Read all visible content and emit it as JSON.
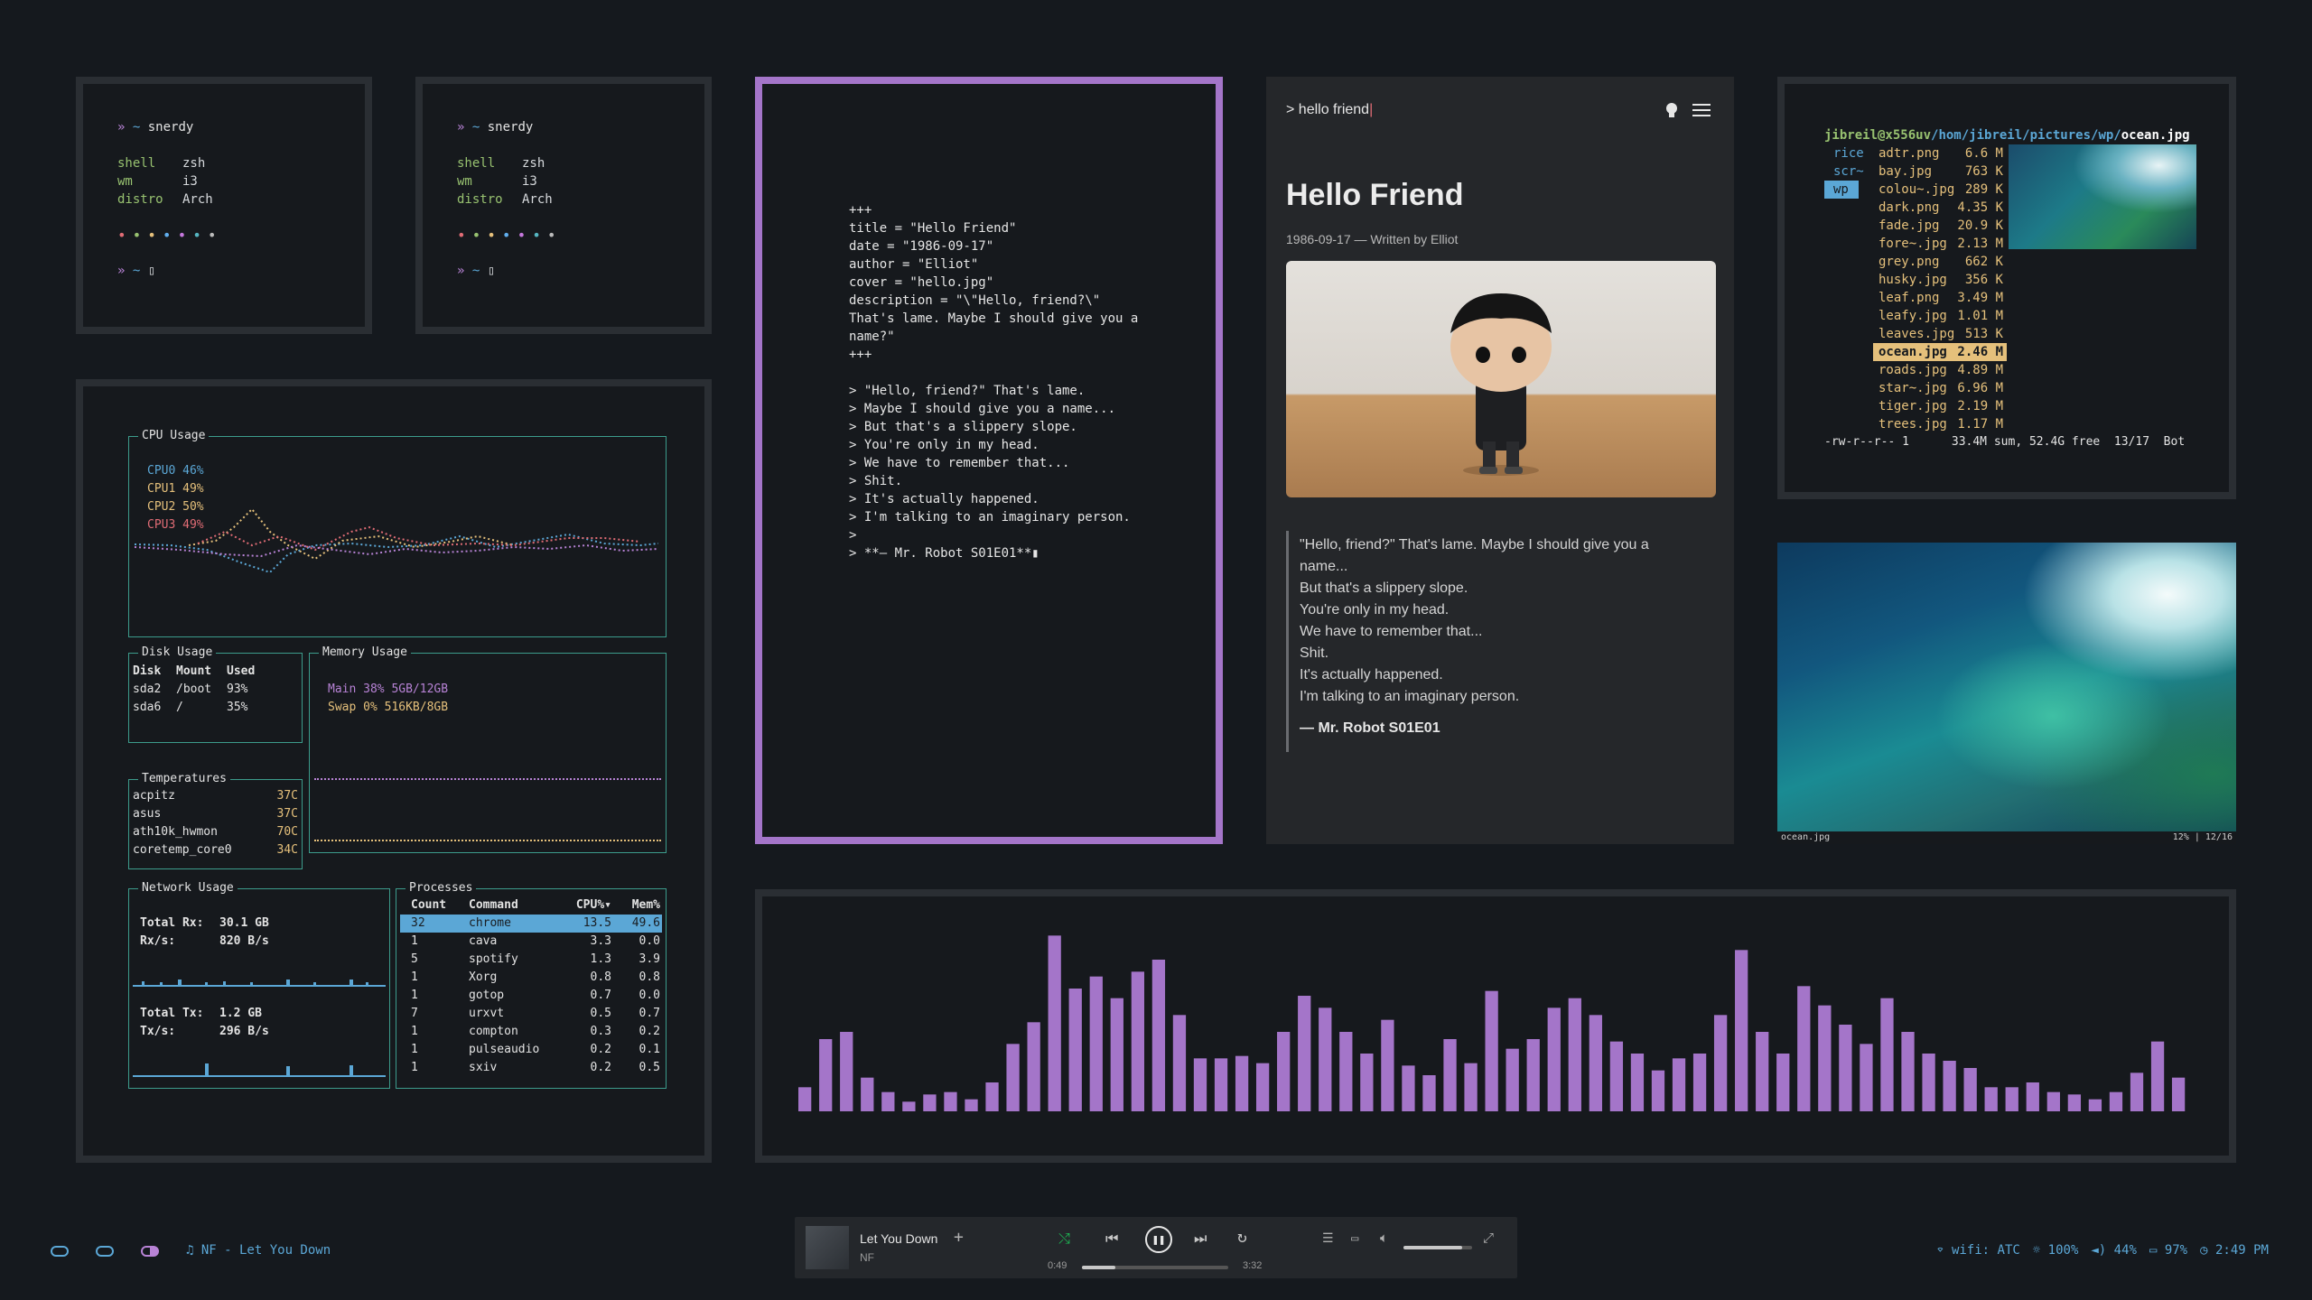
{
  "neofetch": [
    {
      "prompt": "»  ~ snerdy",
      "rows": [
        [
          "shell",
          "zsh"
        ],
        [
          "wm",
          "i3"
        ],
        [
          "distro",
          "Arch"
        ]
      ],
      "dots": "• • • • • • •",
      "prompt2": "»  ~ ▯"
    },
    {
      "prompt": "»  ~ snerdy",
      "rows": [
        [
          "shell",
          "zsh"
        ],
        [
          "wm",
          "i3"
        ],
        [
          "distro",
          "Arch"
        ]
      ],
      "dots": "• • • • • • •",
      "prompt2": "»  ~ ▯"
    }
  ],
  "gotop": {
    "cpu_title": "CPU Usage",
    "cpus": [
      {
        "label": "CPU0",
        "val": "46%"
      },
      {
        "label": "CPU1",
        "val": "49%"
      },
      {
        "label": "CPU2",
        "val": "50%"
      },
      {
        "label": "CPU3",
        "val": "49%"
      }
    ],
    "disk_title": "Disk Usage",
    "disk_headers": [
      "Disk",
      "Mount",
      "Used"
    ],
    "disks": [
      [
        "sda2",
        "/boot",
        "93%"
      ],
      [
        "sda6",
        "/",
        "35%"
      ]
    ],
    "mem_title": "Memory Usage",
    "mem": [
      {
        "label": "Main",
        "val": "38% 5GB/12GB"
      },
      {
        "label": "Swap",
        "val": "0% 516KB/8GB"
      }
    ],
    "temp_title": "Temperatures",
    "temps": [
      [
        "acpitz",
        "37C"
      ],
      [
        "asus",
        "37C"
      ],
      [
        "ath10k_hwmon",
        "70C"
      ],
      [
        "coretemp_core0",
        "34C"
      ]
    ],
    "net_title": "Network Usage",
    "net": {
      "rx_total_label": "Total Rx:",
      "rx_total": "30.1 GB",
      "rx_rate_label": "Rx/s:",
      "rx_rate": "820  B/s",
      "tx_total_label": "Total Tx:",
      "tx_total": "1.2 GB",
      "tx_rate_label": "Tx/s:",
      "tx_rate": "296  B/s"
    },
    "proc_title": "Processes",
    "proc_headers": [
      "Count",
      "Command",
      "CPU%▾",
      "Mem%"
    ],
    "procs": [
      [
        "32",
        "chrome",
        "13.5",
        "49.6"
      ],
      [
        "1",
        "cava",
        "3.3",
        "0.0"
      ],
      [
        "5",
        "spotify",
        "1.3",
        "3.9"
      ],
      [
        "1",
        "Xorg",
        "0.8",
        "0.8"
      ],
      [
        "1",
        "gotop",
        "0.7",
        "0.0"
      ],
      [
        "7",
        "urxvt",
        "0.5",
        "0.7"
      ],
      [
        "1",
        "compton",
        "0.3",
        "0.2"
      ],
      [
        "1",
        "pulseaudio",
        "0.2",
        "0.1"
      ],
      [
        "1",
        "sxiv",
        "0.2",
        "0.5"
      ]
    ]
  },
  "editor": {
    "lines": [
      "+++",
      "title = \"Hello Friend\"",
      "date = \"1986-09-17\"",
      "author = \"Elliot\"",
      "cover = \"hello.jpg\"",
      "description = \"\\\"Hello, friend?\\\"",
      "That's lame. Maybe I should give you a",
      "name?\"",
      "+++",
      "",
      "> \"Hello, friend?\" That's lame.",
      "> Maybe I should give you a name...",
      "> But that's a slippery slope.",
      "> You're only in my head.",
      "> We have to remember that...",
      "> Shit.",
      "> It's actually happened.",
      "> I'm talking to an imaginary person.",
      ">",
      "> **— Mr. Robot S01E01**▮"
    ]
  },
  "blog": {
    "prompt": "> hello friend",
    "title": "Hello Friend",
    "meta": "1986-09-17 — Written by Elliot",
    "quote": [
      "\"Hello, friend?\" That's lame. Maybe I should give you a",
      "name...",
      "But that's a slippery slope.",
      "You're only in my head.",
      "We have to remember that...",
      "Shit.",
      "It's actually happened.",
      "I'm talking to an imaginary person."
    ],
    "cite": "— Mr. Robot S01E01"
  },
  "ranger": {
    "path_user": "jibreil@x556uv",
    "path_dir": "/hom/jibreil/pictures/wp/",
    "path_file": "ocean.jpg",
    "dirs": [
      "rice",
      "scr~",
      "wp"
    ],
    "files": [
      [
        "adtr.png",
        "6.6 M"
      ],
      [
        "bay.jpg",
        "763 K"
      ],
      [
        "colou~.jpg",
        "289 K"
      ],
      [
        "dark.png",
        "4.35 K"
      ],
      [
        "fade.jpg",
        "20.9 K"
      ],
      [
        "fore~.jpg",
        "2.13 M"
      ],
      [
        "grey.png",
        "662 K"
      ],
      [
        "husky.jpg",
        "356 K"
      ],
      [
        "leaf.png",
        "3.49 M"
      ],
      [
        "leafy.jpg",
        "1.01 M"
      ],
      [
        "leaves.jpg",
        "513 K"
      ],
      [
        "ocean.jpg",
        "2.46 M"
      ],
      [
        "roads.jpg",
        "4.89 M"
      ],
      [
        "star~.jpg",
        "6.96 M"
      ],
      [
        "tiger.jpg",
        "2.19 M"
      ],
      [
        "trees.jpg",
        "1.17 M"
      ]
    ],
    "status": "-rw-r--r-- 1      33.4M sum, 52.4G free  13/17  Bot"
  },
  "sxiv": {
    "name": "ocean.jpg",
    "info": "12% | 12/16"
  },
  "cava": {
    "values": [
      0.1,
      0.3,
      0.33,
      0.14,
      0.08,
      0.04,
      0.07,
      0.08,
      0.05,
      0.12,
      0.28,
      0.37,
      0.73,
      0.51,
      0.56,
      0.47,
      0.58,
      0.63,
      0.4,
      0.22,
      0.22,
      0.23,
      0.2,
      0.33,
      0.48,
      0.43,
      0.33,
      0.24,
      0.38,
      0.19,
      0.15,
      0.3,
      0.2,
      0.5,
      0.26,
      0.3,
      0.43,
      0.47,
      0.4,
      0.29,
      0.24,
      0.17,
      0.22,
      0.24,
      0.4,
      0.67,
      0.33,
      0.24,
      0.52,
      0.44,
      0.36,
      0.28,
      0.47,
      0.33,
      0.24,
      0.21,
      0.18,
      0.1,
      0.1,
      0.12,
      0.08,
      0.07,
      0.05,
      0.08,
      0.16,
      0.29,
      0.14
    ]
  },
  "bar": {
    "song": "NF - Let You Down",
    "player_title": "Let You Down",
    "player_artist": "NF",
    "elapsed": "0:49",
    "total": "3:32",
    "progress": 0.23,
    "volume": 0.85,
    "wifi": "wifi: ATC",
    "brightness": "100%",
    "vol": "44%",
    "battery": "97%",
    "clock": "2:49 PM"
  },
  "colors": {
    "purple": "#a475c9",
    "teal": "#3c9c8c",
    "blue": "#5ba7d6",
    "accent_bar": "#a475c9"
  }
}
